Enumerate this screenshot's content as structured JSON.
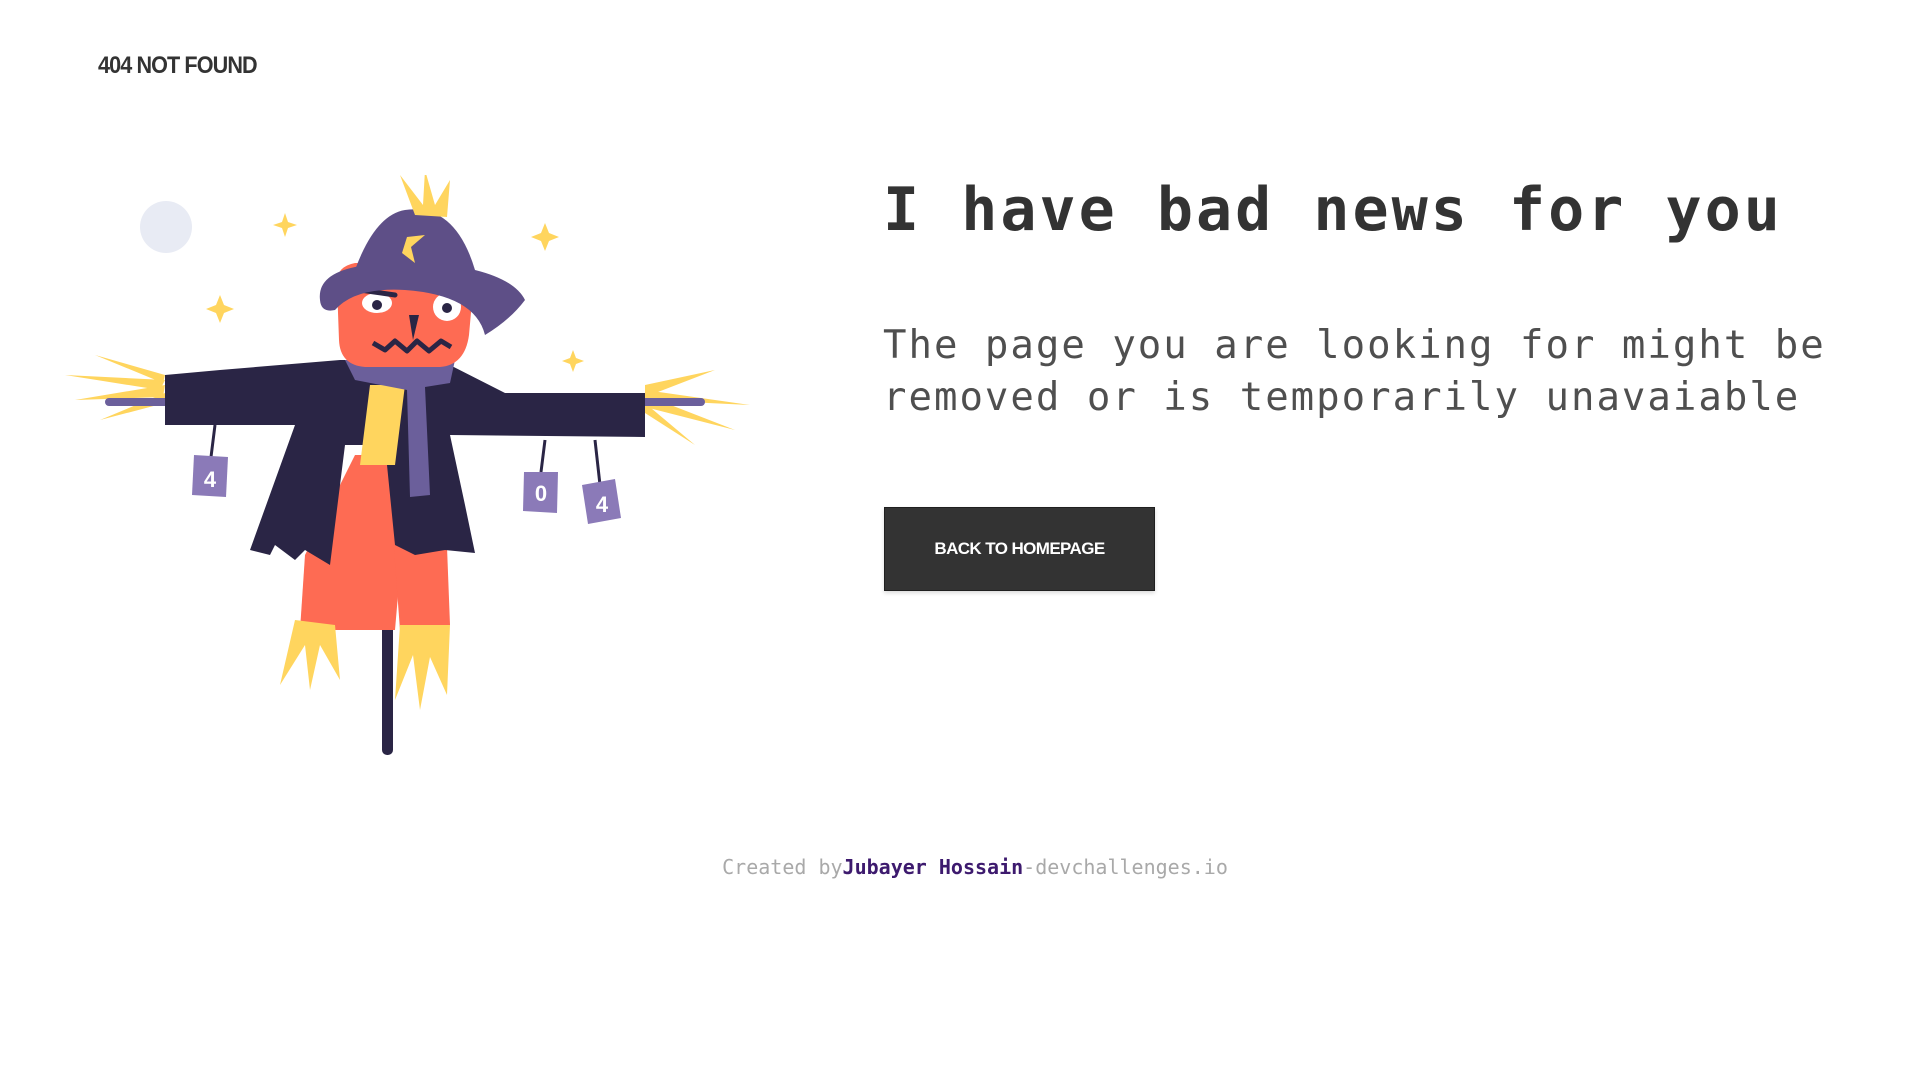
{
  "header": {
    "logo": "404 NOT FOUND"
  },
  "illustration": {
    "alt": "scarecrow-illustration",
    "tin_can_labels": [
      "4",
      "0",
      "4"
    ]
  },
  "main": {
    "headline": "I have bad news for you",
    "subtext": "The page you are looking for might be removed or is temporarily unavaiable",
    "button_label": "BACK TO HOMEPAGE"
  },
  "footer": {
    "prefix": "Created by",
    "author": "Jubayer Hossain",
    "suffix": "-devchallenges.io"
  },
  "colors": {
    "dark": "#333333",
    "hat": "#5e4f87",
    "coat": "#2a2545",
    "orange": "#fe6b53",
    "yellow": "#ffd55e",
    "scarf": "#6b5f9b",
    "moon": "#e8ebf4",
    "author": "#3d1a6e"
  }
}
